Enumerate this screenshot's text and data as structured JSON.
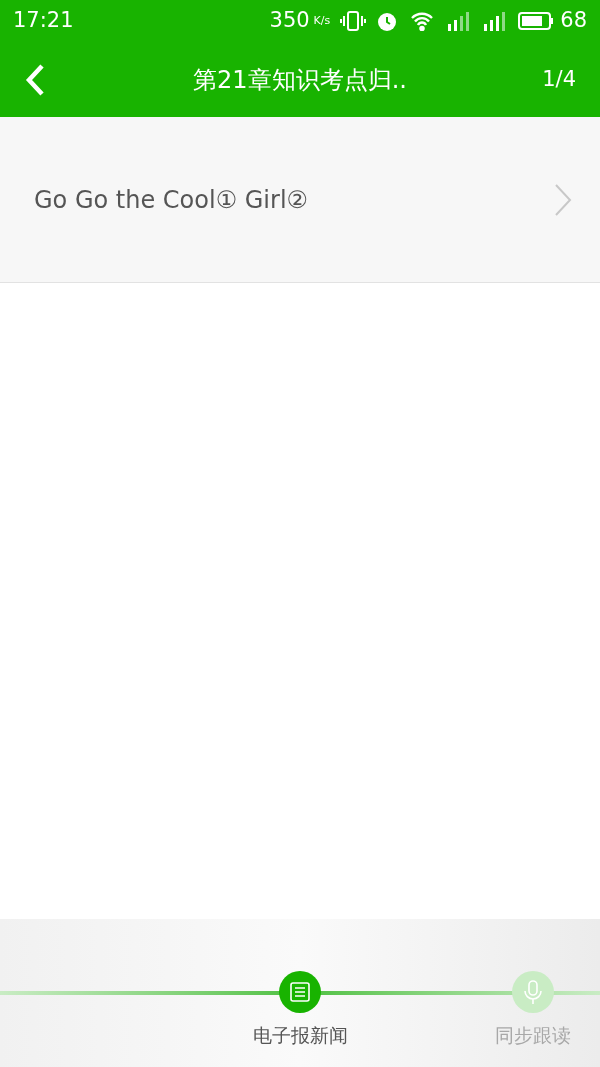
{
  "status_bar": {
    "time": "17:21",
    "speed": "350",
    "speed_unit": "K/s",
    "battery": "68"
  },
  "nav": {
    "title": "第21章知识考点归..",
    "page": "1/4"
  },
  "items": [
    {
      "label": "Go Go the Cool① Girl②"
    }
  ],
  "bottom_tabs": [
    {
      "label": "电子报新闻",
      "kind": "news",
      "selected": true
    },
    {
      "label": "同步跟读",
      "kind": "mic",
      "selected": false
    }
  ]
}
